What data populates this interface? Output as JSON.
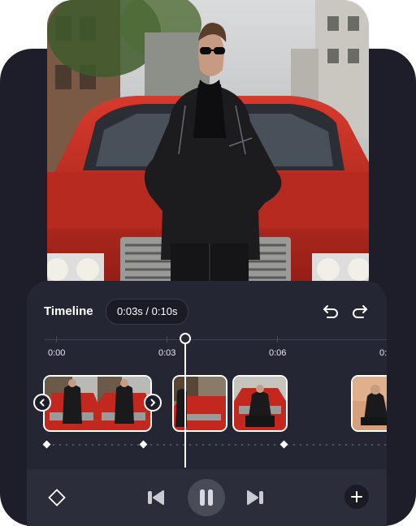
{
  "timeline": {
    "title": "Timeline",
    "time_display": "0:03s / 0:10s"
  },
  "ruler": {
    "labels": [
      "0:00",
      "0:03",
      "0:06",
      "0:"
    ]
  },
  "controls": {
    "icons": [
      "undo-icon",
      "redo-icon",
      "keyframe-diamond-icon",
      "previous-frame-icon",
      "pause-icon",
      "next-frame-icon",
      "add-icon"
    ]
  },
  "colors": {
    "background_dark": "#1d1e2a",
    "panel": "#252634",
    "accent_white": "#ffffff",
    "car_red": "#c2281e"
  }
}
